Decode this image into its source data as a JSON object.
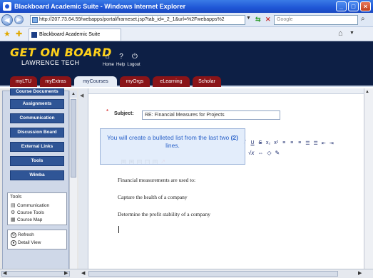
{
  "window": {
    "title": "Blackboard Academic Suite - Windows Internet Explorer",
    "minimize": "_",
    "maximize": "□",
    "close": "×"
  },
  "browser": {
    "url": "http://207.73.64.59/webapps/portal/frameset.jsp?tab_id=_2_1&url=%2Fwebapps%2",
    "search_placeholder": "Google",
    "tab_label": "Blackboard Academic Suite"
  },
  "header": {
    "logo_line1": "GET ON BOARD",
    "logo_line2": "LAWRENCE TECH",
    "links": [
      "Home",
      "Help",
      "Logout"
    ]
  },
  "course_tabs": [
    "myLTU",
    "myExtras",
    "myCourses",
    "myOrgs",
    "eLearning",
    "Scholar"
  ],
  "active_tab": "myCourses",
  "course_menu": {
    "items": [
      "Course Documents",
      "Assignments",
      "Communication",
      "Discussion Board",
      "External Links",
      "Tools",
      "Wimba"
    ]
  },
  "tools_panel": {
    "title": "Tools",
    "items": [
      "Communication",
      "Course Tools",
      "Course Map"
    ]
  },
  "view_panel": {
    "items": [
      "Refresh",
      "Detail View"
    ]
  },
  "form": {
    "subject_label": "Subject:",
    "subject_value": "RE: Financial Measures for Projects"
  },
  "callout": {
    "text_before": "You will create a bulleted list from the last two ",
    "text_bold": "(2)",
    "text_after": " lines."
  },
  "editor": {
    "lines": [
      "Financial measurements are used to:",
      "Capture the health of a company",
      "Determine the profit stability of a company"
    ]
  }
}
